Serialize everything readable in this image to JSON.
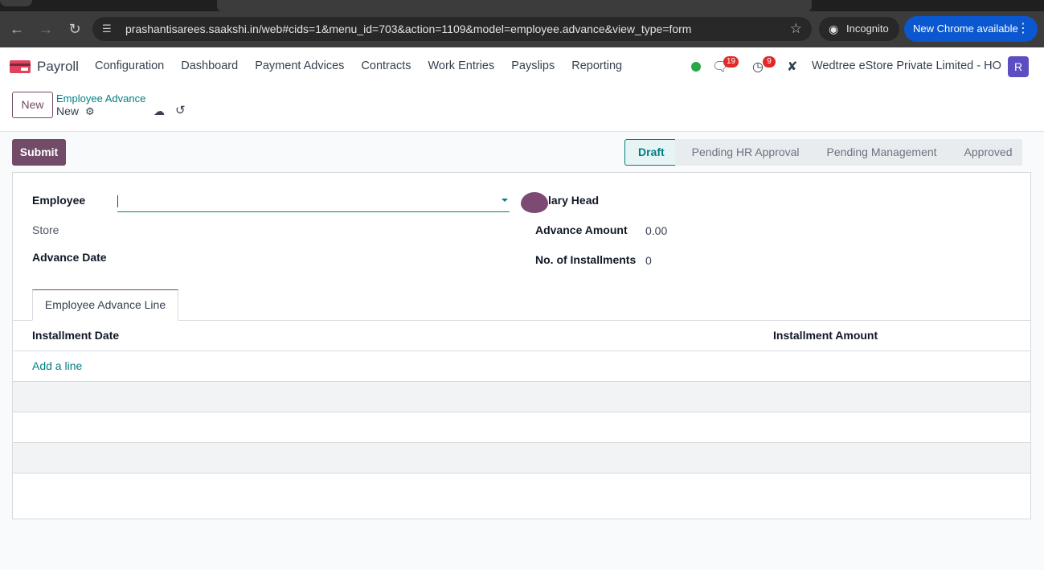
{
  "browser": {
    "url": "prashantisarees.saakshi.in/web#cids=1&menu_id=703&action=1109&model=employee.advance&view_type=form",
    "incognito_label": "Incognito",
    "update_label": "New Chrome available"
  },
  "navbar": {
    "app_name": "Payroll",
    "menu": [
      "Configuration",
      "Dashboard",
      "Payment Advices",
      "Contracts",
      "Work Entries",
      "Payslips",
      "Reporting"
    ],
    "messages_count": "19",
    "activities_count": "9",
    "company": "Wedtree eStore Private Limited - HO",
    "avatar_letter": "R"
  },
  "control": {
    "new_label": "New",
    "breadcrumb_parent": "Employee Advance",
    "breadcrumb_current": "New"
  },
  "form": {
    "submit_label": "Submit",
    "stages": [
      "Draft",
      "Pending HR Approval",
      "Pending Management",
      "Approved"
    ],
    "employee_label": "Employee",
    "store_label": "Store",
    "advance_date_label": "Advance Date",
    "salary_head_label": "lary Head",
    "advance_amount_label": "Advance Amount",
    "advance_amount_value": "0.00",
    "installments_label": "No. of Installments",
    "installments_value": "0",
    "tab_label": "Employee Advance Line",
    "col_date": "Installment Date",
    "col_amount": "Installment Amount",
    "add_line": "Add a line"
  },
  "colors": {
    "brand": "#714b67",
    "link": "#017e84",
    "chrome_blue": "#0b57d0"
  }
}
